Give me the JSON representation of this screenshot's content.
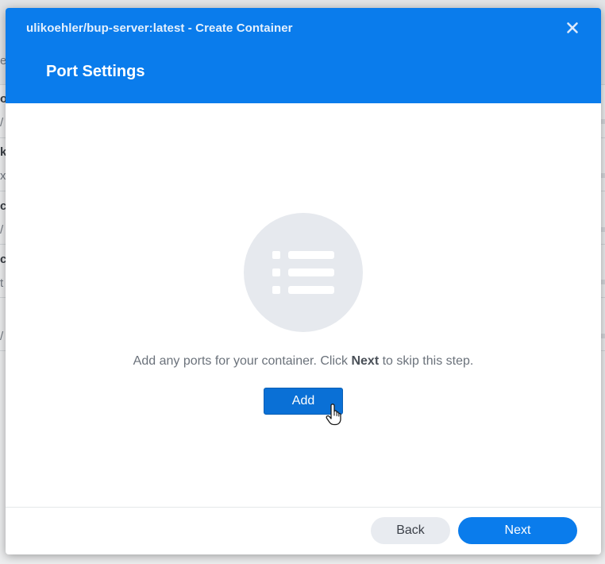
{
  "background": {
    "fragments": [
      "e",
      "o",
      "/",
      "k",
      "x",
      "c",
      "/",
      "c",
      "t",
      "/"
    ]
  },
  "dialog": {
    "title": "ulikoehler/bup-server:latest - Create Container",
    "step_title": "Port Settings",
    "close_icon": "close-icon",
    "empty_state": {
      "icon": "list-icon",
      "hint_before": "Add any ports for your container. Click ",
      "hint_bold": "Next",
      "hint_after": " to skip this step.",
      "add_label": "Add"
    },
    "footer": {
      "back_label": "Back",
      "next_label": "Next"
    }
  },
  "colors": {
    "header": "#0a7cec",
    "primary_button": "#0a70d6",
    "secondary_button": "#e8ebf0"
  }
}
